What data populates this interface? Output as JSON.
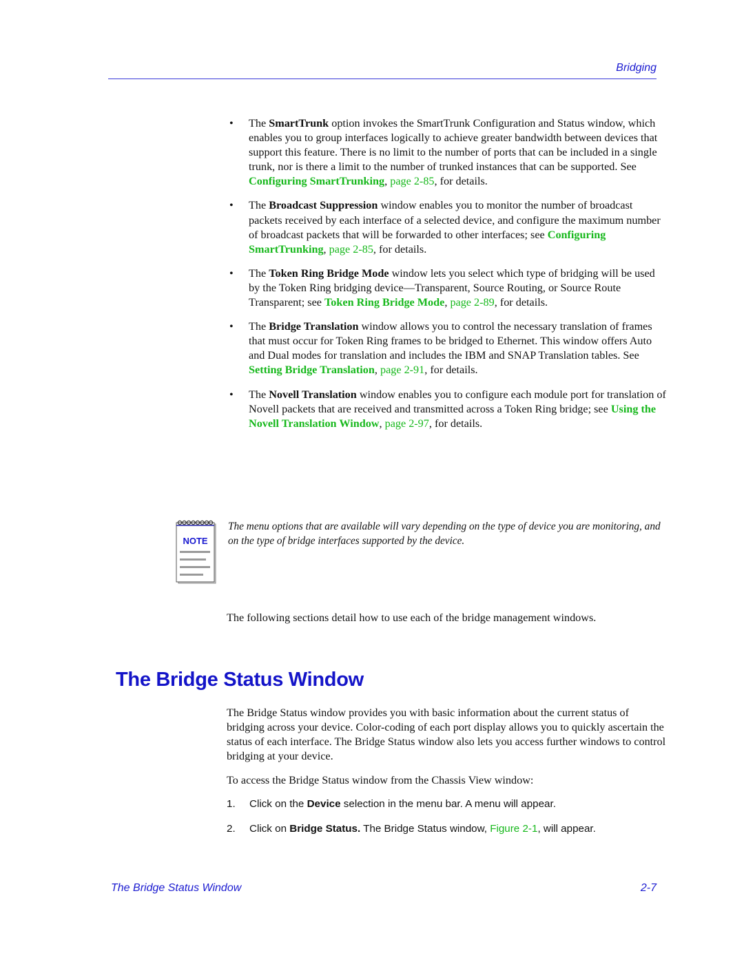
{
  "header": {
    "title": "Bridging"
  },
  "bullets": [
    {
      "pre": "The ",
      "bold": "SmartTrunk",
      "text": " option invokes the SmartTrunk Configuration and Status window, which enables you to group interfaces logically to achieve greater bandwidth between devices that support this feature. There is no limit to the number of ports that can be included in a single trunk, nor is there a limit to the number of trunked instances that can be supported. See ",
      "link_title": "Configuring SmartTrunking",
      "sep": ", ",
      "link_page": "page 2-85",
      "post": ", for details."
    },
    {
      "pre": "The ",
      "bold": "Broadcast Suppression",
      "text": " window enables you to monitor the number of broadcast packets received by each interface of a selected device, and configure the maximum number of broadcast packets that will be forwarded to other interfaces; see ",
      "link_title": "Configuring SmartTrunking",
      "sep": ", ",
      "link_page": "page 2-85",
      "post": ", for details."
    },
    {
      "pre": "The ",
      "bold": "Token Ring Bridge Mode",
      "text": " window lets you select which type of bridging will be used by the Token Ring bridging device—Transparent, Source Routing, or Source Route Transparent; see ",
      "link_title": "Token Ring Bridge Mode",
      "sep": ", ",
      "link_page": "page 2-89",
      "post": ", for details."
    },
    {
      "pre": "The ",
      "bold": "Bridge Translation",
      "text": " window allows you to control the necessary translation of frames that must occur for Token Ring frames to be bridged to Ethernet. This window offers Auto and Dual modes for translation and includes the IBM and SNAP Translation tables. See ",
      "link_title": "Setting Bridge Translation",
      "sep": ", ",
      "link_page": "page 2-91",
      "post": ", for details."
    },
    {
      "pre": "The ",
      "bold": "Novell Translation",
      "text": " window enables you to configure each module port for translation of Novell packets that are received and transmitted across a Token Ring bridge; see ",
      "link_title": "Using the Novell Translation Window",
      "sep": ", ",
      "link_page": "page 2-97",
      "post": ", for details."
    }
  ],
  "bullet_glyph": "•",
  "note": {
    "icon_label": "NOTE",
    "text": "The menu options that are available will vary depending on the type of device you are monitoring, and on the type of bridge interfaces supported by the device."
  },
  "following": "The following sections detail how to use each of the bridge management windows.",
  "section": {
    "title": "The Bridge Status Window",
    "intro": "The Bridge Status window provides you with basic information about the current status of bridging across your device. Color-coding of each port display allows you to quickly ascertain the status of each interface. The Bridge Status window also lets you access further windows to control bridging at your device.",
    "access": "To access the Bridge Status window from the Chassis View window:",
    "steps": [
      {
        "num": "1.",
        "pre": "Click on the ",
        "bold": "Device",
        "post": " selection in the menu bar. A menu will appear.",
        "link": "",
        "tail": ""
      },
      {
        "num": "2.",
        "pre": "Click on ",
        "bold": "Bridge Status.",
        "post": " The Bridge Status window, ",
        "link": "Figure 2-1",
        "tail": ", will appear."
      }
    ]
  },
  "footer": {
    "left": "The Bridge Status Window",
    "right": "2-7"
  },
  "colors": {
    "heading_blue": "#1414c8",
    "link_green": "#17b81c",
    "rule_blue": "#3a3ad8"
  }
}
